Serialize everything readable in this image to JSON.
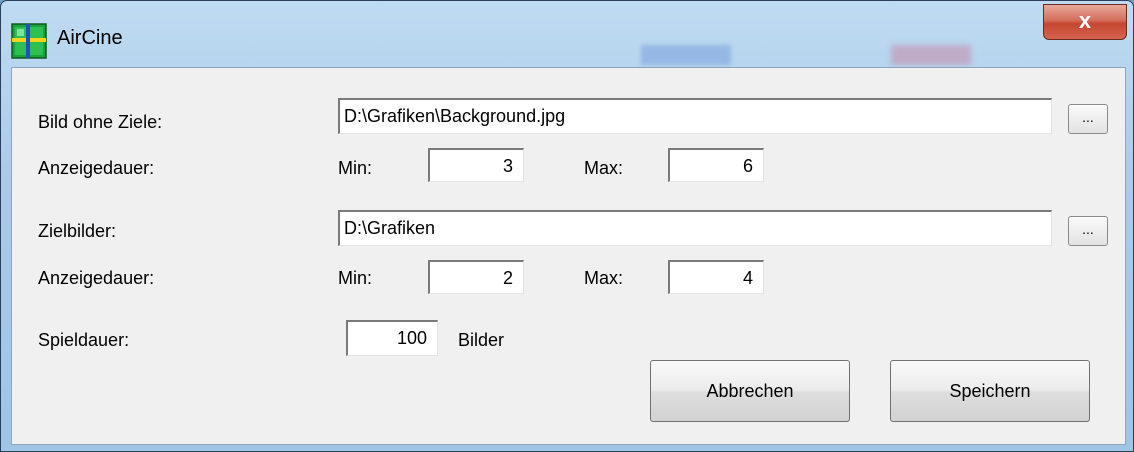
{
  "window": {
    "title": "AirCine",
    "close_glyph": "x"
  },
  "labels": {
    "bild_ohne_ziele": "Bild ohne Ziele:",
    "anzeigedauer": "Anzeigedauer:",
    "zielbilder": "Zielbilder:",
    "spieldauer": "Spieldauer:",
    "min": "Min:",
    "max": "Max:",
    "bilder": "Bilder"
  },
  "bild_ohne_ziele": {
    "path": "D:\\Grafiken\\Background.jpg",
    "browse_label": "...",
    "min": "3",
    "max": "6"
  },
  "zielbilder": {
    "path": "D:\\Grafiken",
    "browse_label": "...",
    "min": "2",
    "max": "4"
  },
  "spieldauer": {
    "value": "100"
  },
  "buttons": {
    "cancel": "Abbrechen",
    "save": "Speichern"
  },
  "icons": {
    "app": "aircine-app-icon",
    "close": "close-icon"
  }
}
